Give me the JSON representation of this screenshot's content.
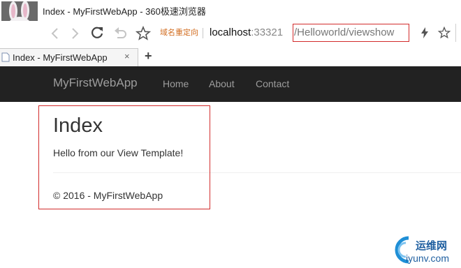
{
  "browser": {
    "window_title": "Index - MyFirstWebApp - 360极速浏览器",
    "address_hint": "域名重定向",
    "url_host": "localhost",
    "url_port": ":33321",
    "url_path": "/Helloworld/viewshow",
    "tab_title": "Index - MyFirstWebApp",
    "tab_close": "×",
    "new_tab": "+"
  },
  "navbar": {
    "brand": "MyFirstWebApp",
    "links": [
      "Home",
      "About",
      "Contact"
    ]
  },
  "page": {
    "title": "Index",
    "message": "Hello from our View Template!",
    "footer": "© 2016 - MyFirstWebApp"
  },
  "watermark": {
    "name": "运维网",
    "domain": "iyunv.com"
  },
  "colors": {
    "navbar_bg": "#222222",
    "nav_text": "#9d9d9d",
    "highlight_box": "#d22b2b",
    "address_hint": "#d26c1f"
  },
  "icons": [
    "back-icon",
    "forward-icon",
    "reload-icon",
    "undo-icon",
    "star-icon",
    "lightning-icon",
    "favorite-icon"
  ]
}
